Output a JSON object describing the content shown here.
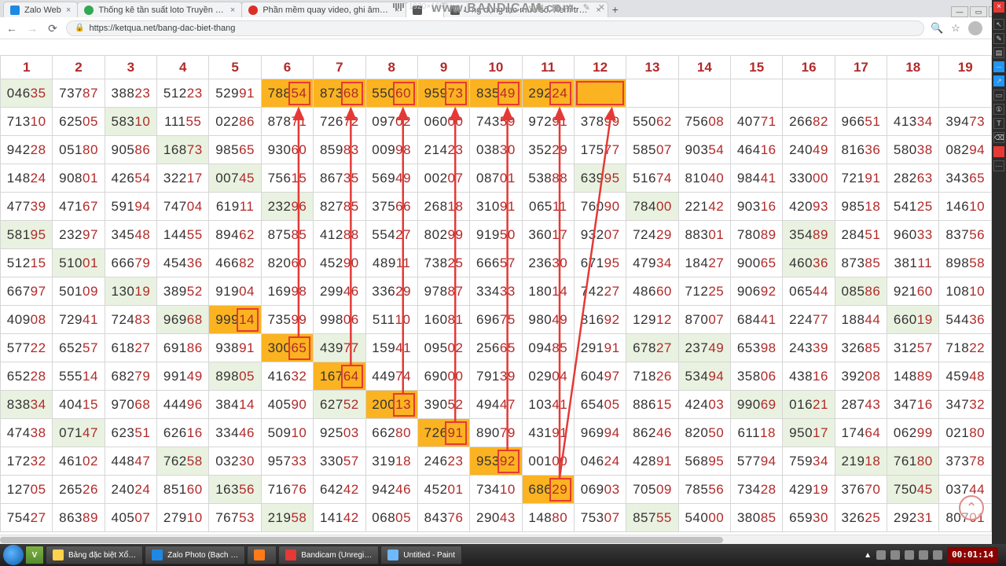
{
  "watermark": "www.BANDICAM.com",
  "rec_dimensions": "1920×1080",
  "tabs": [
    {
      "label": "Zalo Web"
    },
    {
      "label": "Thống kê tần suất loto Truyền Th…"
    },
    {
      "label": "Phần mềm quay video, ghi âm g…"
    },
    {
      "label": ""
    },
    {
      "label": "Ứng dụng tạo mức số. Xem trự…"
    }
  ],
  "address_url": "https://ketqua.net/bang-dac-biet-thang",
  "headers": [
    "1",
    "2",
    "3",
    "4",
    "5",
    "6",
    "7",
    "8",
    "9",
    "10",
    "11",
    "12",
    "13",
    "14",
    "15",
    "16",
    "17",
    "18",
    "19"
  ],
  "rows": [
    [
      "04635",
      "73787",
      "38823",
      "51223",
      "52991",
      "78854",
      "87368",
      "55060",
      "95973",
      "83549",
      "29224",
      "",
      "",
      "",
      "",
      "",
      "",
      "",
      ""
    ],
    [
      "71310",
      "62505",
      "58310",
      "11155",
      "02286",
      "87871",
      "72672",
      "09702",
      "06000",
      "74359",
      "97291",
      "37899",
      "55062",
      "75608",
      "40771",
      "26682",
      "96651",
      "41334",
      "39473"
    ],
    [
      "94228",
      "05180",
      "90586",
      "16873",
      "98565",
      "93060",
      "85983",
      "00998",
      "21423",
      "03830",
      "35229",
      "17577",
      "58507",
      "90354",
      "46416",
      "24049",
      "81636",
      "58038",
      "08294"
    ],
    [
      "14824",
      "90801",
      "42654",
      "32217",
      "00745",
      "75615",
      "86735",
      "56949",
      "00207",
      "08701",
      "53888",
      "63995",
      "51674",
      "81040",
      "98441",
      "33000",
      "72191",
      "28263",
      "34365"
    ],
    [
      "47739",
      "47167",
      "59194",
      "74704",
      "61911",
      "23296",
      "82785",
      "37566",
      "26818",
      "31091",
      "06511",
      "76090",
      "78400",
      "22142",
      "90316",
      "42093",
      "98518",
      "54125",
      "14610"
    ],
    [
      "58195",
      "23297",
      "34548",
      "14455",
      "89462",
      "87585",
      "41288",
      "55427",
      "80299",
      "91950",
      "36017",
      "93207",
      "72429",
      "88301",
      "78089",
      "35489",
      "28451",
      "96033",
      "83756"
    ],
    [
      "51215",
      "51001",
      "66679",
      "45436",
      "46682",
      "82060",
      "45290",
      "48911",
      "73825",
      "66657",
      "23630",
      "67195",
      "47934",
      "18427",
      "90065",
      "46036",
      "87385",
      "38111",
      "89858"
    ],
    [
      "66797",
      "50109",
      "13019",
      "38952",
      "91904",
      "16998",
      "29946",
      "33629",
      "97887",
      "33433",
      "18014",
      "74227",
      "48660",
      "71225",
      "90692",
      "06544",
      "08586",
      "92160",
      "10810"
    ],
    [
      "40908",
      "72941",
      "72483",
      "96968",
      "99914",
      "73599",
      "99806",
      "51110",
      "16081",
      "69675",
      "98049",
      "81692",
      "12912",
      "87007",
      "68441",
      "22477",
      "18844",
      "66019",
      "54436"
    ],
    [
      "57722",
      "65257",
      "61827",
      "69186",
      "93891",
      "30065",
      "43977",
      "15941",
      "09502",
      "25665",
      "09485",
      "29191",
      "67827",
      "23749",
      "65398",
      "24339",
      "32685",
      "31257",
      "71822"
    ],
    [
      "65228",
      "55514",
      "68279",
      "99149",
      "89805",
      "41632",
      "16764",
      "44974",
      "69000",
      "79139",
      "02904",
      "60497",
      "71826",
      "53494",
      "35806",
      "43816",
      "39208",
      "14889",
      "45948"
    ],
    [
      "83834",
      "40415",
      "97068",
      "44496",
      "38414",
      "40590",
      "62752",
      "20013",
      "39052",
      "49447",
      "10341",
      "65405",
      "88615",
      "42403",
      "99069",
      "01621",
      "28743",
      "34716",
      "34732"
    ],
    [
      "47438",
      "07147",
      "62351",
      "62616",
      "33446",
      "50910",
      "92503",
      "66280",
      "72691",
      "89079",
      "43191",
      "96994",
      "86246",
      "82050",
      "61118",
      "95017",
      "17464",
      "06299",
      "02180"
    ],
    [
      "17232",
      "46102",
      "44847",
      "76258",
      "03230",
      "95733",
      "33057",
      "31918",
      "24623",
      "95392",
      "00100",
      "04624",
      "42891",
      "56895",
      "57794",
      "75934",
      "21918",
      "76180",
      "37378"
    ],
    [
      "12705",
      "26526",
      "24024",
      "85160",
      "16356",
      "71676",
      "64242",
      "94246",
      "45201",
      "73410",
      "68629",
      "06903",
      "70509",
      "78556",
      "73428",
      "42919",
      "37670",
      "75045",
      "03744"
    ],
    [
      "75427",
      "86389",
      "40507",
      "27910",
      "76753",
      "21958",
      "14142",
      "06805",
      "84376",
      "29043",
      "14880",
      "75307",
      "85755",
      "54000",
      "38085",
      "65930",
      "32625",
      "29231",
      "80701"
    ]
  ],
  "shaded": {
    "0": [
      0
    ],
    "1": [
      2
    ],
    "2": [
      3
    ],
    "3": [
      4,
      11
    ],
    "4": [
      5,
      12
    ],
    "5": [
      0,
      15
    ],
    "6": [
      1,
      15
    ],
    "7": [
      2,
      16
    ],
    "8": [
      3,
      4,
      17
    ],
    "9": [
      6,
      12,
      13
    ],
    "10": [
      4,
      13
    ],
    "11": [
      0,
      6,
      14,
      15
    ],
    "12": [
      1,
      15
    ],
    "13": [
      3,
      16,
      17
    ],
    "14": [
      4,
      17
    ],
    "15": [
      5,
      12
    ]
  },
  "highlights": [
    {
      "r": 0,
      "c": 5,
      "box": "right"
    },
    {
      "r": 0,
      "c": 6,
      "box": "right"
    },
    {
      "r": 0,
      "c": 7,
      "box": "right"
    },
    {
      "r": 0,
      "c": 8,
      "box": "right"
    },
    {
      "r": 0,
      "c": 9,
      "box": "right"
    },
    {
      "r": 0,
      "c": 10,
      "box": "right"
    },
    {
      "r": 0,
      "c": 11,
      "box": "full",
      "empty": true
    },
    {
      "r": 8,
      "c": 4,
      "box": "right"
    },
    {
      "r": 9,
      "c": 5,
      "box": "right"
    },
    {
      "r": 10,
      "c": 6,
      "box": "right"
    },
    {
      "r": 11,
      "c": 7,
      "box": "right"
    },
    {
      "r": 12,
      "c": 8,
      "box": "right"
    },
    {
      "r": 13,
      "c": 9,
      "box": "right"
    },
    {
      "r": 14,
      "c": 10,
      "box": "right"
    }
  ],
  "arrows": [
    {
      "from": {
        "r": 9,
        "c": 5
      },
      "to": {
        "r": 0,
        "c": 5
      }
    },
    {
      "from": {
        "r": 10,
        "c": 6
      },
      "to": {
        "r": 0,
        "c": 6
      }
    },
    {
      "from": {
        "r": 11,
        "c": 7
      },
      "to": {
        "r": 0,
        "c": 7
      }
    },
    {
      "from": {
        "r": 12,
        "c": 8
      },
      "to": {
        "r": 0,
        "c": 8
      }
    },
    {
      "from": {
        "r": 13,
        "c": 9
      },
      "to": {
        "r": 0,
        "c": 9
      }
    },
    {
      "from": {
        "r": 14,
        "c": 10
      },
      "to": {
        "r": 0,
        "c": 10
      }
    },
    {
      "from": {
        "r": 14,
        "c": 10
      },
      "to": {
        "r": 0,
        "c": 11
      }
    }
  ],
  "taskbar": {
    "items": [
      {
        "label": "Bảng đặc biệt Xổ…",
        "ico": "#ffd24d"
      },
      {
        "label": "Zalo Photo (Bạch …",
        "ico": "#1e88e5"
      },
      {
        "label": "",
        "ico": "#ff7b1a"
      },
      {
        "label": "Bandicam (Unregi…",
        "ico": "#e53935"
      },
      {
        "label": "Untitled - Paint",
        "ico": "#6fb7ff"
      }
    ],
    "rec_timer": "00:01:14",
    "v_icon": "V"
  },
  "scroll_top_glyph": "⌃"
}
